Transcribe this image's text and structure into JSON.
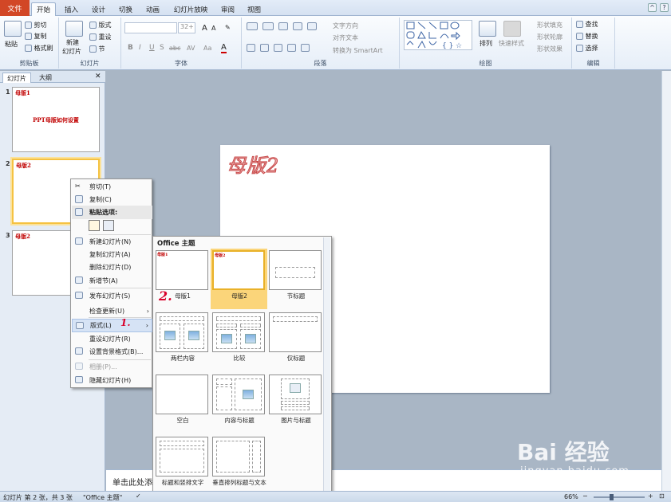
{
  "ribbon_tabs": [
    "文件",
    "开始",
    "插入",
    "设计",
    "切换",
    "动画",
    "幻灯片放映",
    "审阅",
    "视图"
  ],
  "clipboard": {
    "paste": "粘贴",
    "cut": "剪切",
    "copy": "复制",
    "format_painter": "格式刷",
    "label": "剪贴板"
  },
  "slides_group": {
    "new_slide": "新建",
    "new_slide2": "幻灯片",
    "layout": "版式",
    "reset": "重设",
    "section": "节",
    "label": "幻灯片"
  },
  "font_group": {
    "size": "32+",
    "label": "字体",
    "bold": "B",
    "italic": "I",
    "underline": "U",
    "strike": "S",
    "shadow": "abc",
    "spacing": "AV",
    "case": "Aa",
    "color": "A"
  },
  "paragraph_group": {
    "text_direction": "文字方向",
    "align_text": "对齐文本",
    "smartart": "转换为 SmartArt",
    "label": "段落"
  },
  "drawing_group": {
    "arrange": "排列",
    "quick_styles": "快速样式",
    "shape_fill": "形状填充",
    "shape_outline": "形状轮廓",
    "shape_effects": "形状效果",
    "label": "绘图"
  },
  "editing_group": {
    "find": "查找",
    "replace": "替换",
    "select": "选择",
    "label": "编辑"
  },
  "panel": {
    "tab_slides": "幻灯片",
    "tab_outline": "大纲",
    "close": "✕"
  },
  "thumbnails": [
    {
      "num": "1",
      "title": "母版1",
      "body": "PPT母版如何设置"
    },
    {
      "num": "2",
      "title": "母版2",
      "body": ""
    },
    {
      "num": "3",
      "title": "母版2",
      "body": ""
    }
  ],
  "slide": {
    "title": "母版2"
  },
  "notes_placeholder": "单击此处添加备注",
  "context_menu": {
    "cut": "剪切(T)",
    "copy": "复制(C)",
    "paste_options": "粘贴选项:",
    "new_slide": "新建幻灯片(N)",
    "duplicate": "复制幻灯片(A)",
    "delete": "删除幻灯片(D)",
    "add_section": "新增节(A)",
    "publish": "发布幻灯片(S)",
    "check_updates": "检查更新(U)",
    "layout": "版式(L)",
    "reset": "重设幻灯片(R)",
    "format_bg": "设置背景格式(B)...",
    "photo_album": "相册(P)...",
    "hide": "隐藏幻灯片(H)"
  },
  "gallery": {
    "header": "Office 主题",
    "layouts": [
      "母版1",
      "母版2",
      "节标题",
      "两栏内容",
      "比较",
      "仅标题",
      "空白",
      "内容与标题",
      "图片与标题",
      "标题和竖排文字",
      "垂直排列标题与文本"
    ]
  },
  "annotations": {
    "one": "1.",
    "two": "2."
  },
  "status": {
    "slide_info": "幻灯片 第 2 张，共 3 张",
    "theme": "\"Office 主题\"",
    "zoom": "66%"
  },
  "watermark": {
    "brand": "Bai 经验",
    "url": "jingyan.baidu.com"
  }
}
